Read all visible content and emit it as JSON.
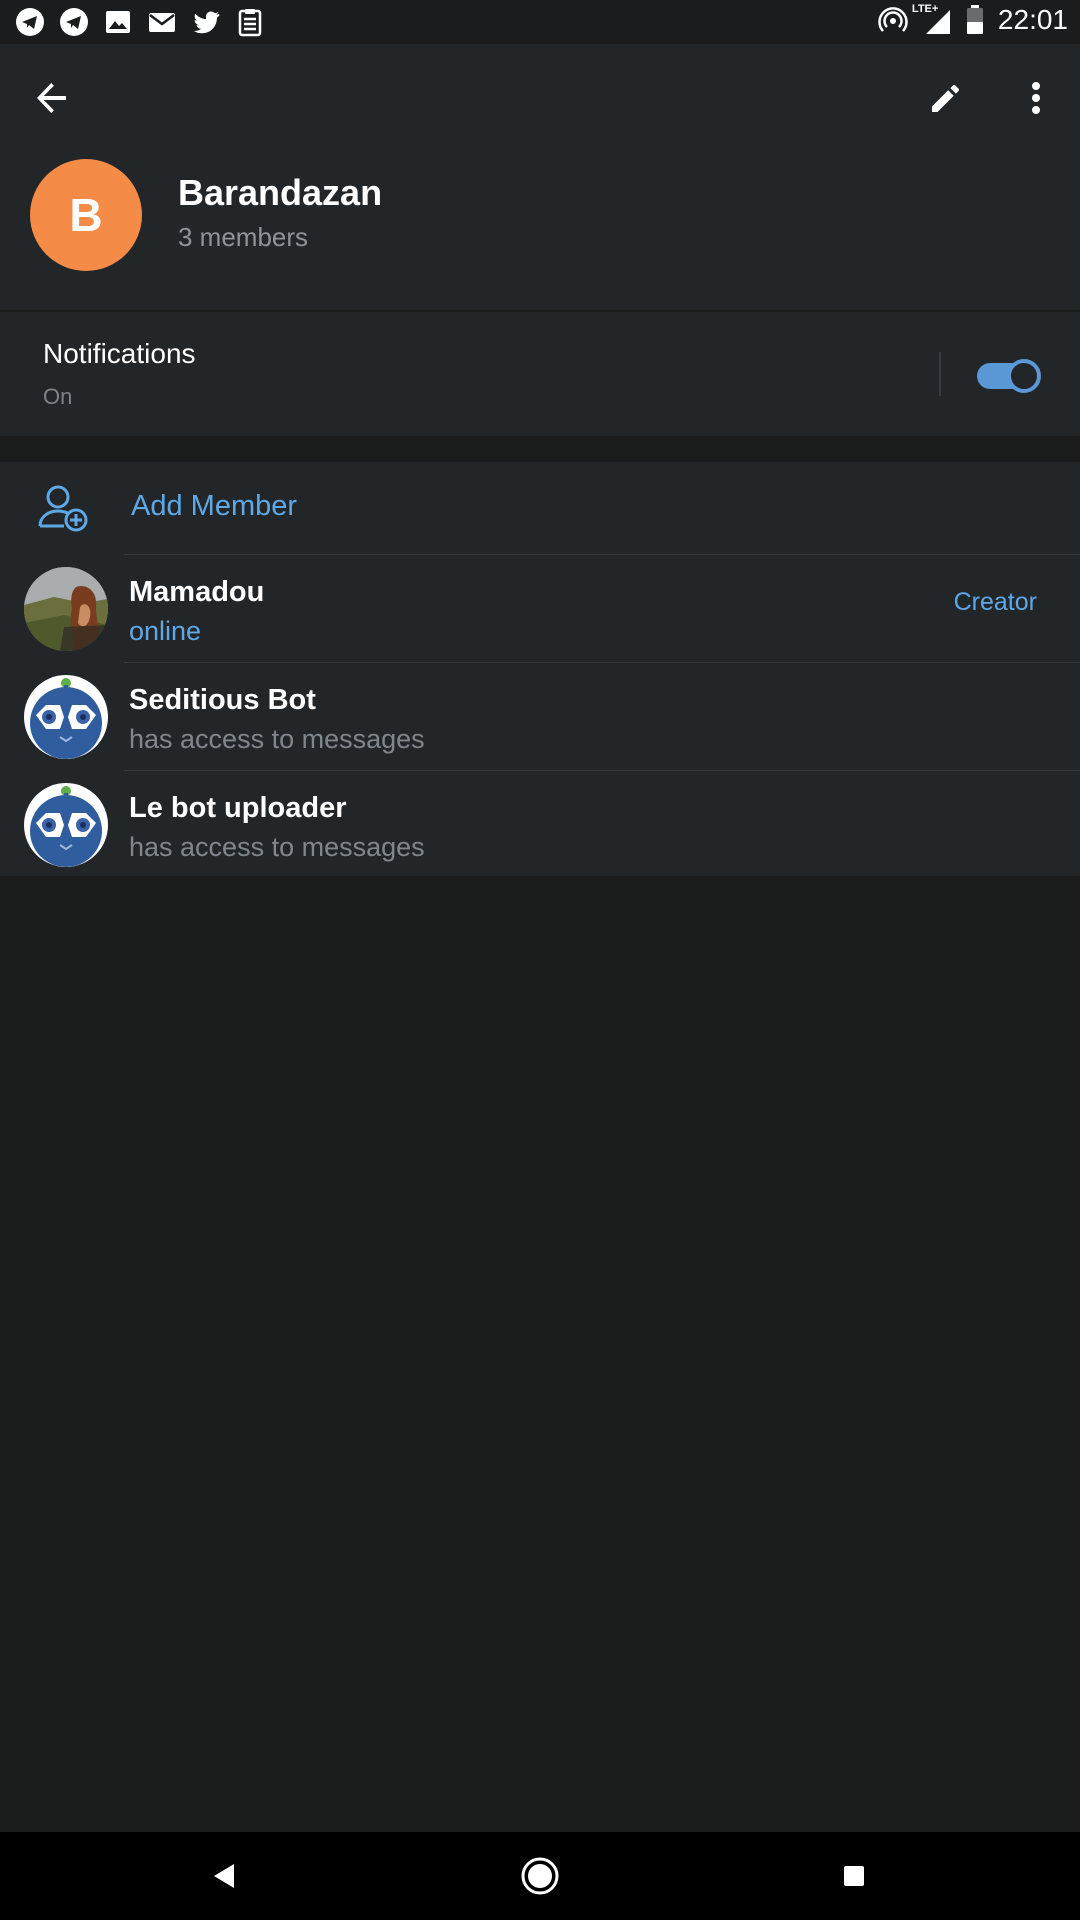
{
  "status_bar": {
    "notification_icons": [
      "telegram-icon",
      "telegram-icon",
      "image-icon",
      "mail-icon",
      "twitter-icon",
      "clipboard-icon"
    ],
    "right_icons": [
      "hotspot-icon",
      "signal-lte-icon",
      "battery-icon"
    ],
    "network": "LTE+",
    "time": "22:01"
  },
  "toolbar": {
    "back_icon": "arrow-back-icon",
    "edit_icon": "pencil-icon",
    "more_icon": "more-vert-icon"
  },
  "group": {
    "avatar_letter": "B",
    "avatar_color": "#f48b47",
    "name": "Barandazan",
    "member_count": "3 members"
  },
  "notifications": {
    "title": "Notifications",
    "value": "On",
    "enabled": true,
    "accent": "#5a98d6"
  },
  "members": {
    "add_label": "Add Member",
    "list": [
      {
        "name": "Mamadou",
        "status": "online",
        "role": "Creator",
        "avatar": "photo"
      },
      {
        "name": "Seditious Bot",
        "status": "has access to messages",
        "role": "",
        "avatar": "bot"
      },
      {
        "name": "Le bot uploader",
        "status": "has access to messages",
        "role": "",
        "avatar": "bot"
      }
    ]
  },
  "colors": {
    "background": "#1a1b1b",
    "panel": "#232629",
    "link": "#5ea8e6",
    "secondary_text": "#8e9499"
  }
}
